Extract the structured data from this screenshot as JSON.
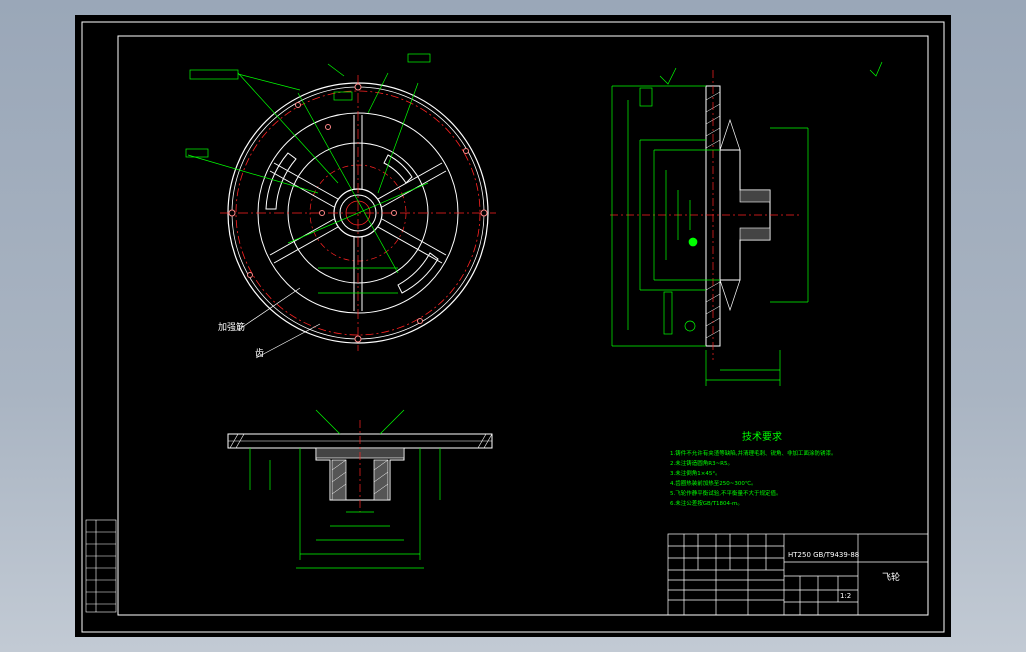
{
  "colors": {
    "background": "#000000",
    "frame": "#ffffff",
    "dimension": "#00ff00",
    "section": "#ffffff",
    "centerline": "#ff2222",
    "surround": "#a9b4c2"
  },
  "drawing": {
    "notes_title": "技术要求",
    "notes": [
      "1.铸件不允许有夹渣等缺陷,并清理毛刺、锐角、非加工面涂防锈漆。",
      "2.未注铸造圆角R3~R5。",
      "3.未注倒角1×45°。",
      "4.齿圈热装前加热至250~300℃。",
      "5.飞轮作静平衡试验,不平衡量不大于规定值。",
      "6.未注公差按GB/T1804-m。"
    ],
    "material": "HT250 GB/T9439-88",
    "part_name": "飞轮",
    "scale": "1:2",
    "callout_leader_a": "加强筋",
    "callout_leader_b": "齿"
  },
  "icons": [
    "roughness-symbol",
    "datum-symbol",
    "tolerance-frame"
  ]
}
